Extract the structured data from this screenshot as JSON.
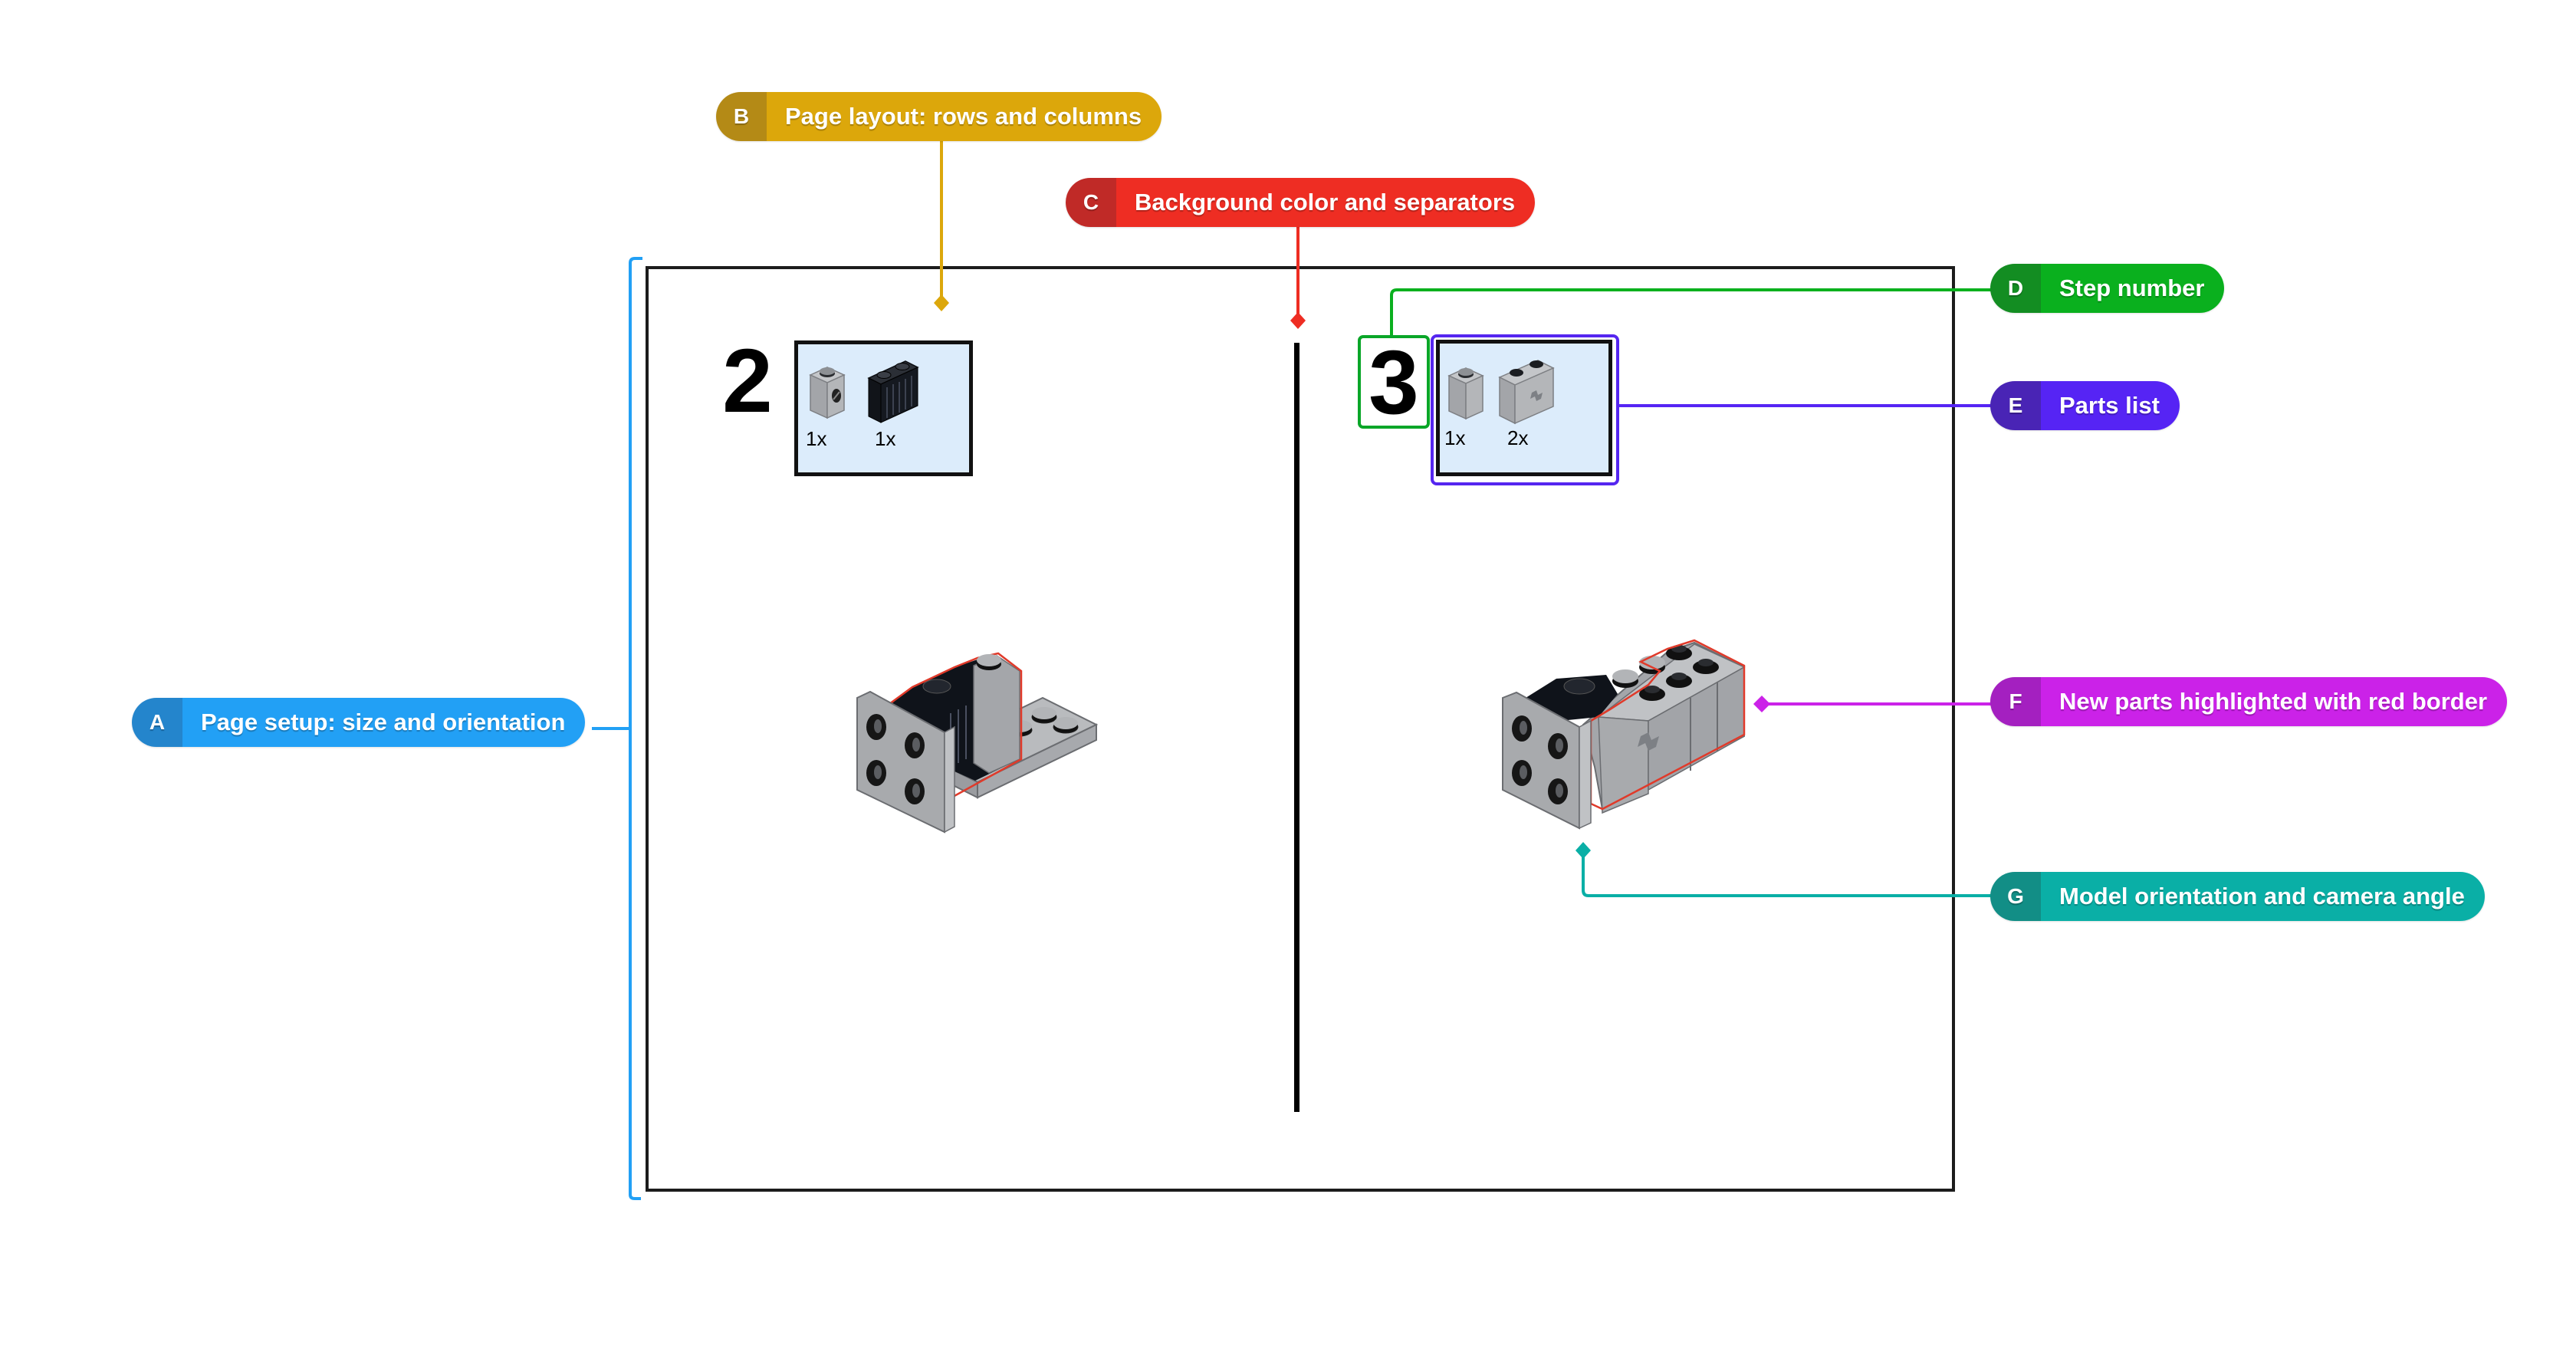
{
  "colors": {
    "page_border": "#1c1c1c",
    "parts_background": "#dcecfb",
    "new_part_outline": "#e03a2a",
    "brick_light_gray": "#a3a5a9",
    "brick_black": "#0e1218"
  },
  "annotations": [
    {
      "letter": "A",
      "label": "Page setup: size and orientation",
      "color": "#22a0f5",
      "letter_color": "#2485cc"
    },
    {
      "letter": "B",
      "label": "Page layout: rows and columns",
      "color": "#dca70b",
      "letter_color": "#b48a16"
    },
    {
      "letter": "C",
      "label": "Background color and separators",
      "color": "#ee2d23",
      "letter_color": "#c02a27"
    },
    {
      "letter": "D",
      "label": "Step number",
      "color": "#0ab01e",
      "letter_color": "#138d22"
    },
    {
      "letter": "E",
      "label": "Parts list",
      "color": "#5624f4",
      "letter_color": "#4924b5"
    },
    {
      "letter": "F",
      "label": "New parts highlighted with red border",
      "color": "#cb22e8",
      "letter_color": "#a420c0"
    },
    {
      "letter": "G",
      "label": "Model orientation and camera angle",
      "color": "#0aafa6",
      "letter_color": "#128e86"
    }
  ],
  "steps": [
    {
      "number": "2",
      "parts": [
        {
          "icon": "brick-1x1-with-side-stud-light-gray",
          "quantity": "1x"
        },
        {
          "icon": "brick-1x2-grille-black",
          "quantity": "1x"
        }
      ],
      "model": "bracket-with-black-grille-brick"
    },
    {
      "number": "3",
      "parts": [
        {
          "icon": "brick-1x1-light-gray",
          "quantity": "1x"
        },
        {
          "icon": "technic-brick-1x2-axle-hole-light-gray",
          "quantity": "2x"
        }
      ],
      "model": "bracket-with-gray-bricks-row"
    }
  ]
}
